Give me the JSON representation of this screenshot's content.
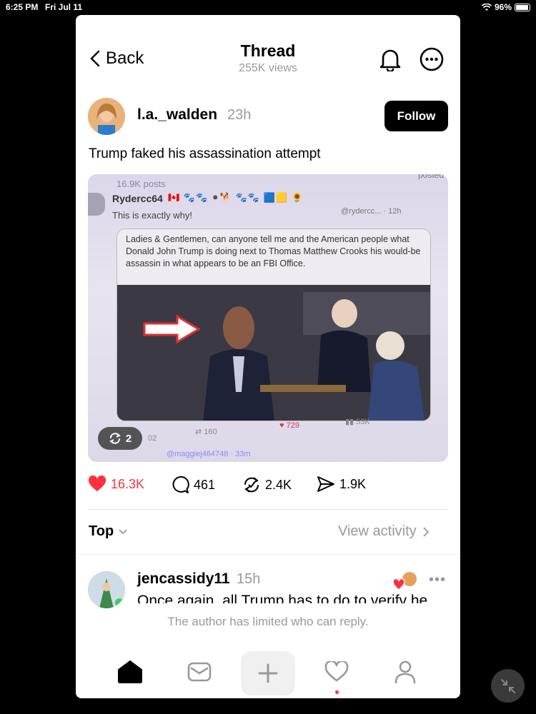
{
  "status_bar": {
    "time": "6:25 PM",
    "date": "Fri Jul 11",
    "battery": "96%",
    "battery_level": 0.96
  },
  "header": {
    "back_label": "Back",
    "title": "Thread",
    "views": "255K views"
  },
  "post": {
    "username": "l.a._walden",
    "time": "23h",
    "follow_label": "Follow",
    "text": "Trump faked his assassination attempt",
    "media": {
      "posts_count": "16.9K posts",
      "posted_fragment": "posted",
      "embedded_user": "Ryder​cc64",
      "embedded_handle": "@rydercc... · 12h",
      "embedded_subtitle": "This is exactly why!",
      "quote_text": "Ladies & Gentlemen, can anyone tell me and the American people what Donald John Trump is doing next to Thomas Matthew Crooks his would-be assassin in what appears to be an FBI Office.",
      "retweets": "160",
      "likes": "729",
      "views": "53K",
      "left_count": "02",
      "bottom_handle": "@maggiej464748 · 33m",
      "repost_chip": "2"
    },
    "stats": {
      "likes": "16.3K",
      "replies": "461",
      "reposts": "2.4K",
      "shares": "1.9K"
    }
  },
  "sort": {
    "label": "Top",
    "view_activity": "View activity"
  },
  "reply": {
    "username": "jencassidy11",
    "time": "15h",
    "text": "Once again, all Trump has to do to verify he"
  },
  "limited_text": "The author has limited who can reply."
}
